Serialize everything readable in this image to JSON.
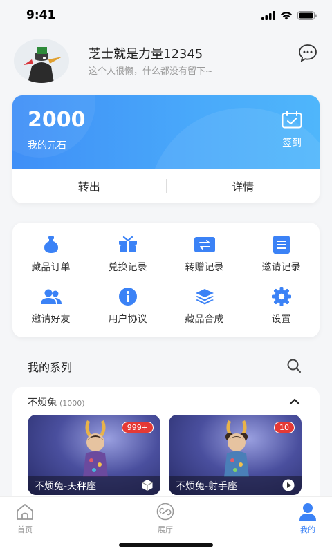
{
  "status_bar": {
    "time": "9:41"
  },
  "profile": {
    "username": "芝士就是力量12345",
    "bio": "这个人很懒，什么都没有留下~"
  },
  "wallet": {
    "balance": "2000",
    "balance_label": "我的元石",
    "signin_label": "签到",
    "actions": [
      "转出",
      "详情"
    ]
  },
  "services": [
    {
      "label": "藏品订单",
      "icon": "vase-icon"
    },
    {
      "label": "兑换记录",
      "icon": "gift-icon"
    },
    {
      "label": "转赠记录",
      "icon": "transfer-icon"
    },
    {
      "label": "邀请记录",
      "icon": "document-icon"
    },
    {
      "label": "邀请好友",
      "icon": "users-icon"
    },
    {
      "label": "用户协议",
      "icon": "info-icon"
    },
    {
      "label": "藏品合成",
      "icon": "layers-icon"
    },
    {
      "label": "设置",
      "icon": "gear-icon"
    }
  ],
  "series_section": {
    "title": "我的系列"
  },
  "series": {
    "name": "不烦兔",
    "count": "(1000)",
    "items": [
      {
        "name": "不烦兔-天秤座",
        "badge": "999+",
        "type_icon": "cube-icon"
      },
      {
        "name": "不烦兔-射手座",
        "badge": "10",
        "type_icon": "play-icon"
      }
    ]
  },
  "tabbar": {
    "tabs": [
      {
        "label": "首页",
        "icon": "home-icon"
      },
      {
        "label": "展厅",
        "icon": "link-icon"
      },
      {
        "label": "我的",
        "icon": "user-icon"
      }
    ],
    "active": "我的"
  },
  "colors": {
    "accent": "#3b82f6",
    "wallet_start": "#3f8ff7",
    "wallet_end": "#4fb6fb",
    "badge": "#e53935"
  }
}
